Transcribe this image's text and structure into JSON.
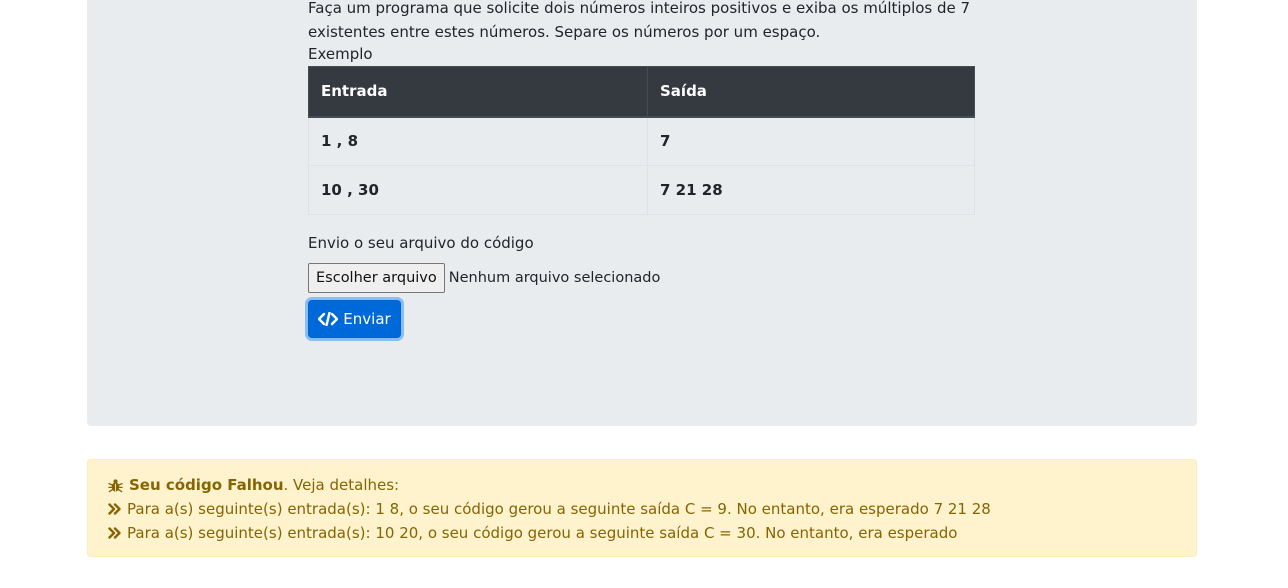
{
  "problem": {
    "description_line1": "Faça um programa que solicite dois números inteiros positivos e exiba os múltiplos de 7",
    "description_line2": "existentes entre estes números. Separe os números por um espaço.",
    "example_label": "Exemplo",
    "table": {
      "headers": [
        "Entrada",
        "Saída"
      ],
      "rows": [
        [
          "1 , 8",
          "7"
        ],
        [
          "10 , 30",
          "7 21 28"
        ]
      ]
    }
  },
  "upload": {
    "label": "Envio o seu arquivo do código",
    "choose_button": "Escolher arquivo",
    "status": "Nenhum arquivo selecionado",
    "submit_label": "Enviar",
    "submit_icon": "code-icon"
  },
  "result": {
    "title_bold": "Seu código Falhou",
    "title_rest": ". Veja detalhes:",
    "icon": "bug-icon",
    "details": [
      "Para a(s) seguinte(s) entrada(s): 1 8, o seu código gerou a seguinte saída C = 9. No entanto, era esperado 7 21 28",
      "Para a(s) seguinte(s) entrada(s): 10 20, o seu código gerou a seguinte saída C = 30. No entanto, era esperado"
    ],
    "detail_icon": "double-chevron-right-icon"
  },
  "colors": {
    "card_bg": "#e9ecef",
    "table_header_bg": "#343a40",
    "primary": "#0069d9",
    "alert_bg": "#fff3cd",
    "alert_text": "#856404"
  }
}
